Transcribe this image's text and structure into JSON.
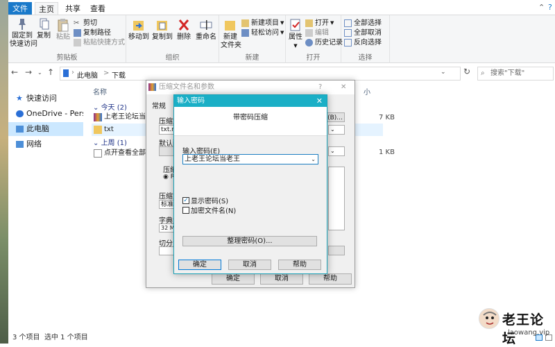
{
  "tabs": {
    "file": "文件",
    "home": "主页",
    "share": "共享",
    "view": "查看"
  },
  "ribbon": {
    "clipboard": {
      "pin": "固定到\n快速访问",
      "copy": "复制",
      "paste": "粘贴",
      "cut": "剪切",
      "copy_path": "复制路径",
      "paste_shortcut": "粘贴快捷方式",
      "label": "剪贴板"
    },
    "organize": {
      "move_to": "移动到",
      "copy_to": "复制到",
      "delete": "删除",
      "rename": "重命名",
      "label": "组织"
    },
    "new": {
      "new_folder": "新建\n文件夹",
      "new_item": "新建项目",
      "easy_access": "轻松访问",
      "label": "新建"
    },
    "open": {
      "properties": "属性",
      "open": "打开",
      "edit": "编辑",
      "history": "历史记录",
      "label": "打开"
    },
    "select": {
      "select_all": "全部选择",
      "select_none": "全部取消",
      "invert": "反向选择",
      "label": "选择"
    }
  },
  "address": {
    "path1": "此电脑",
    "sep": ">",
    "path2": "下载",
    "search_placeholder": "搜索\"下载\""
  },
  "sidebar": {
    "items": [
      {
        "label": "快速访问"
      },
      {
        "label": "OneDrive - Persona"
      },
      {
        "label": "此电脑"
      },
      {
        "label": "网络"
      }
    ]
  },
  "filelist": {
    "col_name": "名称",
    "col_size": "小",
    "group_today": "今天 (2)",
    "group_lastweek": "上周 (1)",
    "rows": [
      {
        "name": "上老王论坛当老王",
        "size": "7 KB"
      },
      {
        "name": "txt",
        "size": ""
      },
      {
        "name": "点开查看全部链接",
        "size": "1 KB"
      }
    ]
  },
  "status": {
    "count": "3 个项目",
    "selected": "选中 1 个项目"
  },
  "compress_dialog": {
    "title": "压缩文件名和参数",
    "help": "?",
    "close": "✕",
    "tab_general": "常规",
    "label_compress": "压缩文",
    "archive_name": "txt.rar",
    "browse": "(B)...",
    "label_default": "默认配",
    "label_format": "压缩",
    "radio_rar": "RA",
    "label_method": "压缩方",
    "method_value": "标准",
    "label_dict": "字典大",
    "dict_value": "32 MB",
    "label_split": "切分为",
    "ok": "确定",
    "cancel": "取消",
    "help_btn": "帮助"
  },
  "password_dialog": {
    "title": "输入密码",
    "close": "✕",
    "header": "带密码压缩",
    "label_password": "输入密码(E)",
    "password_value": "上老王论坛当老王",
    "show_password": "显示密码(S)",
    "encrypt_names": "加密文件名(N)",
    "organize": "整理密码(O)...",
    "ok": "确定",
    "cancel": "取消",
    "help": "帮助"
  },
  "watermark": {
    "title": "老王论坛",
    "url": "laowang.vip"
  },
  "colors": {
    "accent": "#1979ca",
    "dialog_title": "#1aafc6",
    "selection": "#cce8ff"
  }
}
